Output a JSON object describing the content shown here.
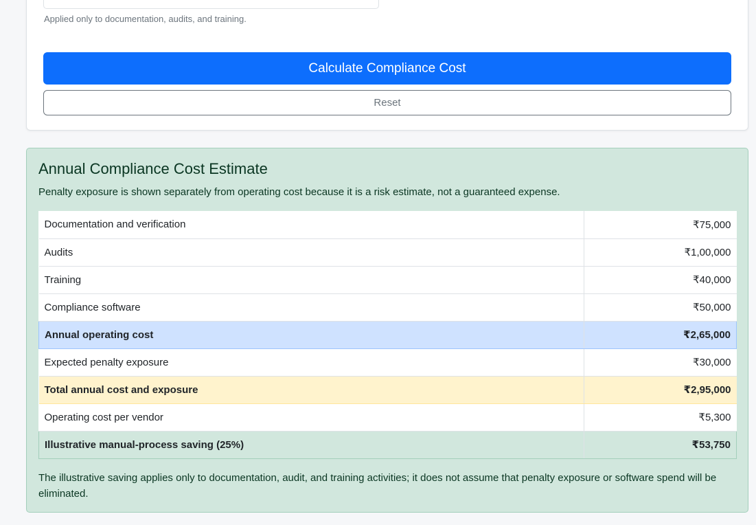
{
  "form": {
    "help_text": "Applied only to documentation, audits, and training.",
    "calculate_label": "Calculate Compliance Cost",
    "reset_label": "Reset"
  },
  "result": {
    "title": "Annual Compliance Cost Estimate",
    "subtitle": "Penalty exposure is shown separately from operating cost because it is a risk estimate, not a guaranteed expense.",
    "rows": [
      {
        "label": "Documentation and verification",
        "value": "₹75,000"
      },
      {
        "label": "Audits",
        "value": "₹1,00,000"
      },
      {
        "label": "Training",
        "value": "₹40,000"
      },
      {
        "label": "Compliance software",
        "value": "₹50,000"
      },
      {
        "label": "Annual operating cost",
        "value": "₹2,65,000"
      },
      {
        "label": "Expected penalty exposure",
        "value": "₹30,000"
      },
      {
        "label": "Total annual cost and exposure",
        "value": "₹2,95,000"
      },
      {
        "label": "Operating cost per vendor",
        "value": "₹5,300"
      },
      {
        "label": "Illustrative manual-process saving (25%)",
        "value": "₹53,750"
      }
    ],
    "footnote": "The illustrative saving applies only to documentation, audit, and training activities; it does not assume that penalty exposure or software spend will be eliminated."
  },
  "colors": {
    "primary_button": "#0d6efd",
    "result_background": "#d1e7dd",
    "highlight_operating": "#cfe2ff",
    "highlight_total": "#fff3cd"
  }
}
